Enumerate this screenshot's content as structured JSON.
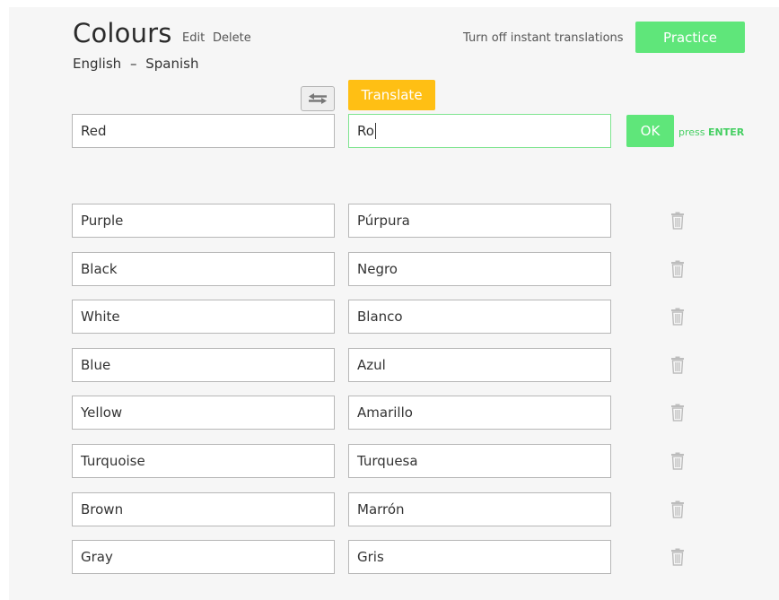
{
  "header": {
    "title": "Colours",
    "edit_label": "Edit",
    "delete_label": "Delete",
    "source_language": "English",
    "language_separator": "–",
    "target_language": "Spanish",
    "instant_translations_label": "Turn off instant translations",
    "practice_label": "Practice"
  },
  "entry": {
    "swap_icon": "swap-arrows-icon",
    "translate_label": "Translate",
    "source_value": "Red",
    "target_value": "Ro",
    "ok_label": "OK",
    "hint_prefix": "press",
    "hint_key": "ENTER"
  },
  "words": [
    {
      "source": "Purple",
      "target": "Púrpura"
    },
    {
      "source": "Black",
      "target": "Negro"
    },
    {
      "source": "White",
      "target": "Blanco"
    },
    {
      "source": "Blue",
      "target": "Azul"
    },
    {
      "source": "Yellow",
      "target": "Amarillo"
    },
    {
      "source": "Turquoise",
      "target": "Turquesa"
    },
    {
      "source": "Brown",
      "target": "Marrón"
    },
    {
      "source": "Gray",
      "target": "Gris"
    }
  ],
  "delete_icon": "trash-icon",
  "colors": {
    "practice_button": "#5fe67a",
    "translate_button": "#ffbf14",
    "active_field_border": "#7ee48f",
    "hint_text": "#45cf62"
  }
}
